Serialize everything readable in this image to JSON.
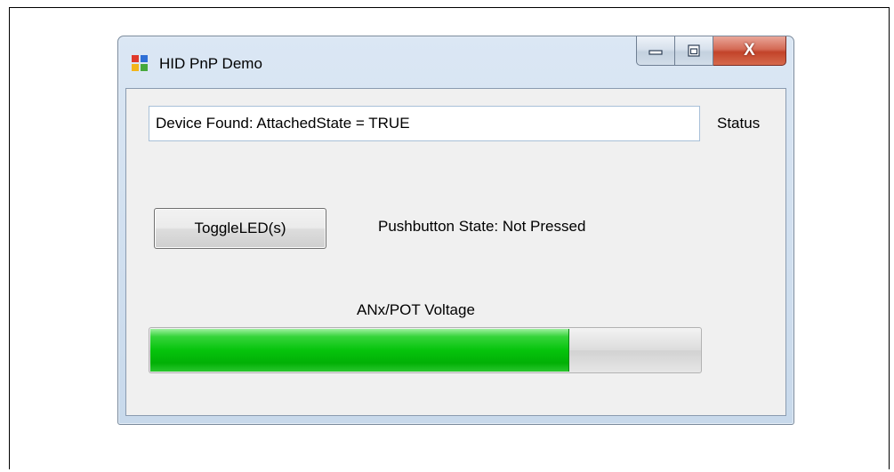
{
  "window": {
    "title": "HID PnP Demo",
    "caption_buttons": {
      "minimize_icon": "minimize-icon",
      "maximize_icon": "maximize-icon",
      "close_glyph": "X"
    }
  },
  "status": {
    "value": "Device Found: AttachedState = TRUE",
    "label": "Status"
  },
  "toggle_button": {
    "label": "ToggleLED(s)"
  },
  "pushbutton_state": {
    "text": "Pushbutton State: Not Pressed"
  },
  "pot": {
    "label": "ANx/POT Voltage",
    "progress_fraction": 0.76
  },
  "colors": {
    "progress_fill": "#06c40c",
    "close_button": "#c2432a"
  }
}
